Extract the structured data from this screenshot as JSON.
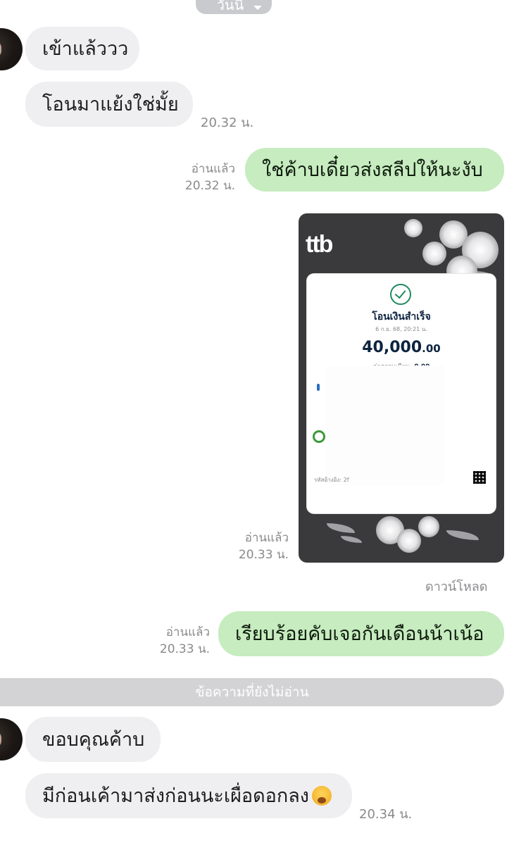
{
  "date_pill": {
    "label": "วันนี้"
  },
  "messages": {
    "m1": {
      "text": "เข้าแล้ววว"
    },
    "m2": {
      "text": "โอนมาแย้งใช่มั้ย",
      "time": "20.32 น."
    },
    "m3": {
      "text": "ใช่ค้าบเดี๋ยวส่งสลีปให้นะงับ",
      "read": "อ่านแล้ว",
      "time": "20.32 น."
    },
    "m4": {
      "read": "อ่านแล้ว",
      "time": "20.33 น.",
      "download": "ดาวน์โหลด"
    },
    "m5": {
      "text": "เรียบร้อยคับเจอกันเดือนน้าเน้อ",
      "read": "อ่านแล้ว",
      "time": "20.33 น."
    },
    "m6": {
      "text": "ขอบคุณค้าบ"
    },
    "m7": {
      "text": "มีก่อนเค้ามาส่งก่อนนะเผื่อดอกลง",
      "emoji": "hand-over-mouth-emoji",
      "time": "20.34 น."
    }
  },
  "slip": {
    "logo": "ttb",
    "title": "โอนเงินสำเร็จ",
    "date": "6 ก.ย. 68, 20:21 น.",
    "amount_main": "40,000",
    "amount_decimal": ".00",
    "fee_label": "ค่าธรรมเนียม",
    "fee_value": "0.00",
    "ref": "รหัสอ้างอิง: 2f"
  },
  "unread_separator": "ข้อความที่ยังไม่อ่าน",
  "colors": {
    "incoming_bubble": "#efeff1",
    "outgoing_bubble": "#c6ecbf",
    "meta_text": "#8a8a8e"
  }
}
